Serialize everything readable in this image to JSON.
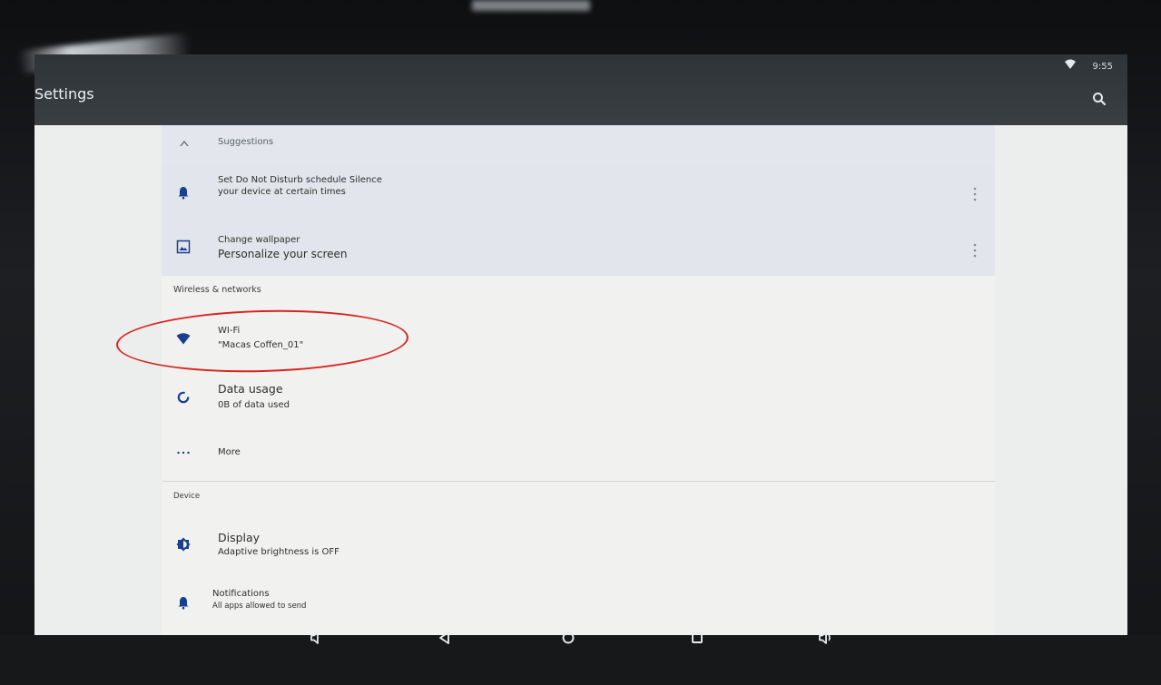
{
  "status_bar": {
    "time": "9:55",
    "wifi_icon": "wifi-icon"
  },
  "app_bar": {
    "title": "Settings",
    "search_icon": "search-icon"
  },
  "suggestions": {
    "header": "Suggestions",
    "items": [
      {
        "icon": "bell-icon",
        "line1": "Set Do Not Disturb schedule Silence",
        "line2": "your device at certain times"
      },
      {
        "icon": "wallpaper-icon",
        "title": "Change wallpaper",
        "subtitle": "Personalize your screen"
      }
    ]
  },
  "wireless": {
    "label": "Wireless & networks",
    "wifi": {
      "icon": "wifi-icon",
      "title": "WI-Fi",
      "subtitle": "\"Macas Coffen_01\""
    },
    "data_usage": {
      "icon": "data-usage-icon",
      "title": "Data usage",
      "subtitle": "0B of data used"
    },
    "more": {
      "icon": "more-dots-icon",
      "title": "More"
    }
  },
  "device": {
    "label": "Device",
    "display": {
      "icon": "brightness-icon",
      "title": "Display",
      "subtitle": "Adaptive brightness is OFF"
    },
    "notifications": {
      "icon": "bell-icon",
      "title": "Notifications",
      "subtitle": "All apps allowed to send"
    }
  },
  "nav_bar": [
    "volume-down-icon",
    "back-icon",
    "home-icon",
    "recents-icon",
    "volume-up-icon"
  ],
  "colors": {
    "accent": "#1a3f8f",
    "highlight": "#d9231f",
    "appbar": "#343a3e"
  }
}
